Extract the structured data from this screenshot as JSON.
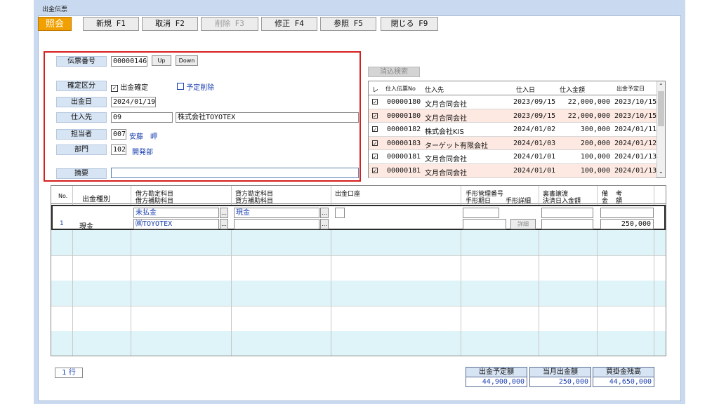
{
  "window": {
    "title": "出金伝票"
  },
  "mode": "照会",
  "toolbar": [
    {
      "label": "新規 F1",
      "enabled": true
    },
    {
      "label": "取消 F2",
      "enabled": true
    },
    {
      "label": "削除 F3",
      "enabled": false
    },
    {
      "label": "修正 F4",
      "enabled": true
    },
    {
      "label": "参照 F5",
      "enabled": true
    },
    {
      "label": "閉じる F9",
      "enabled": true
    }
  ],
  "form": {
    "denpyo_label": "伝票番号",
    "denpyo_value": "00000146",
    "up": "Up",
    "down": "Down",
    "kakutei_label": "確定区分",
    "kakutei_text": "出金確定",
    "yotei_text": "予定削除",
    "date_label": "出金日",
    "date_value": "2024/01/19",
    "supplier_label": "仕入先",
    "supplier_code": "09",
    "supplier_name": "株式会社TOYOTEX",
    "staff_label": "担当者",
    "staff_code": "007",
    "staff_name": "安藤　岬",
    "dept_label": "部門",
    "dept_code": "102",
    "dept_name": "開発部",
    "memo_label": "摘要",
    "memo_value": ""
  },
  "search_button": "消込検索",
  "right_table": {
    "headers": [
      "レ",
      "仕入伝票No",
      "仕入先",
      "仕入日",
      "仕入金額",
      "出金予定日"
    ],
    "rows": [
      {
        "no": "00000180",
        "supplier": "文月合同会社",
        "date": "2023/09/15",
        "amount": "22,000,000",
        "due": "2023/10/15"
      },
      {
        "no": "00000180",
        "supplier": "文月合同会社",
        "date": "2023/09/15",
        "amount": "22,000,000",
        "due": "2023/10/15"
      },
      {
        "no": "00000182",
        "supplier": "株式会社KIS",
        "date": "2024/01/02",
        "amount": "300,000",
        "due": "2024/01/11"
      },
      {
        "no": "00000183",
        "supplier": "ターゲット有限会社",
        "date": "2024/01/03",
        "amount": "200,000",
        "due": "2024/01/12"
      },
      {
        "no": "00000181",
        "supplier": "文月合同会社",
        "date": "2024/01/01",
        "amount": "100,000",
        "due": "2024/01/13"
      },
      {
        "no": "00000181",
        "supplier": "文月合同会社",
        "date": "2024/01/01",
        "amount": "100,000",
        "due": "2024/01/13"
      }
    ]
  },
  "lines_table": {
    "h_no": "No.",
    "h_type": "出金種別",
    "h_debit1": "借方勘定科目",
    "h_debit2": "借方補助科目",
    "h_credit1": "貸方勘定科目",
    "h_credit2": "貸方補助科目",
    "h_account": "出金口座",
    "h_bill1": "手形管理番号",
    "h_bill2": "手形期日",
    "h_bill3": "手形詳細",
    "h_endorse1": "裏書譲渡",
    "h_endorse2": "決済日入金額",
    "h_memo1": "備",
    "h_memo2": "考",
    "h_amt1": "金",
    "h_amt2": "額",
    "row": {
      "no": "1",
      "type": "現金",
      "debit": "未払金",
      "debit_sub": "㈱TOYOTEX",
      "credit": "現金",
      "detail": "詳細",
      "amount": "250,000"
    }
  },
  "row_count": "1 行",
  "summary": [
    {
      "label": "出金予定額",
      "value": "44,900,000"
    },
    {
      "label": "当月出金額",
      "value": "250,000"
    },
    {
      "label": "買掛金残高",
      "value": "44,650,000"
    }
  ]
}
